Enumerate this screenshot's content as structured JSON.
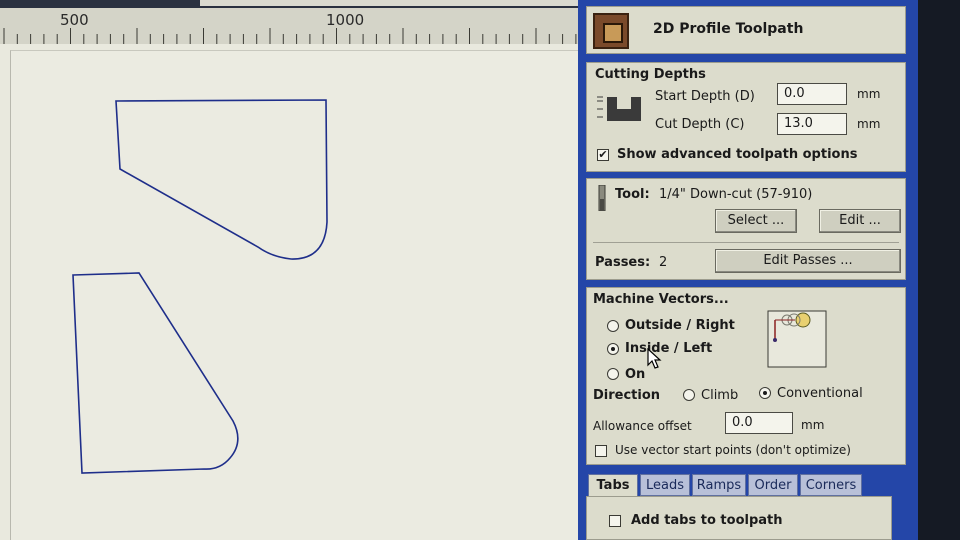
{
  "ruler": {
    "labels": [
      "500",
      "1000"
    ]
  },
  "panel": {
    "title": "2D Profile Toolpath",
    "cutting_depths": {
      "heading": "Cutting Depths",
      "start_depth_label": "Start Depth (D)",
      "start_depth_value": "0.0",
      "cut_depth_label": "Cut Depth (C)",
      "cut_depth_value": "13.0",
      "unit": "mm",
      "show_advanced_label": "Show advanced toolpath options",
      "show_advanced_checked": true
    },
    "tool": {
      "label": "Tool:",
      "name": "1/4\" Down-cut (57-910)",
      "select_label": "Select ...",
      "edit_label": "Edit ...",
      "passes_label": "Passes:",
      "passes_value": "2",
      "edit_passes_label": "Edit Passes ..."
    },
    "machine_vectors": {
      "heading": "Machine Vectors...",
      "options": [
        "Outside / Right",
        "Inside / Left",
        "On"
      ],
      "selected": "Inside / Left",
      "direction_label": "Direction",
      "direction_options": [
        "Climb",
        "Conventional"
      ],
      "direction_selected": "Conventional",
      "allowance_label": "Allowance offset",
      "allowance_value": "0.0",
      "allowance_unit": "mm",
      "vector_start_label": "Use vector start points (don't optimize)",
      "vector_start_checked": false
    },
    "tabs": {
      "items": [
        "Tabs",
        "Leads",
        "Ramps",
        "Order",
        "Corners"
      ],
      "active": "Tabs",
      "add_tabs_label": "Add tabs to toolpath",
      "add_tabs_checked": false
    }
  },
  "colors": {
    "panel_blue": "#2446a8",
    "panel_bg": "#dcdccc",
    "canvas_bg": "#e9e9de",
    "vector_stroke": "#1e2e8a"
  }
}
